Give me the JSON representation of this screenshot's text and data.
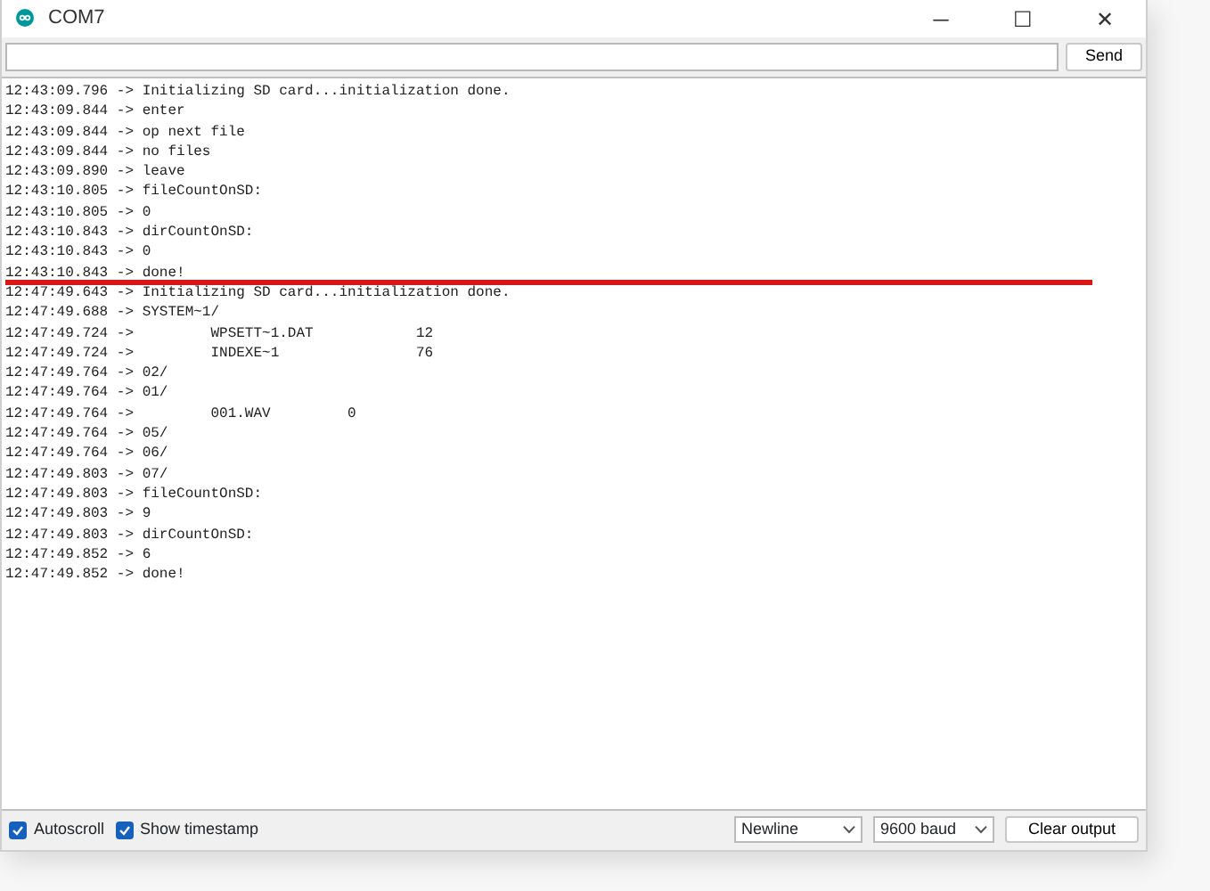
{
  "window": {
    "title": "COM7",
    "controls": [
      "─",
      "☐",
      "✕"
    ]
  },
  "input": {
    "button": "Send"
  },
  "output": {
    "lines": [
      {
        "text": "12:43:09.796 -> Initializing SD card...initialization done.",
        "marked": false
      },
      {
        "text": "12:43:09.844 -> enter",
        "marked": false
      },
      {
        "text": "12:43:09.844 -> op next file",
        "marked": false
      },
      {
        "text": "12:43:09.844 -> no files",
        "marked": false
      },
      {
        "text": "12:43:09.890 -> leave",
        "marked": false
      },
      {
        "text": "12:43:10.805 -> fileCountOnSD:",
        "marked": false
      },
      {
        "text": "12:43:10.805 -> 0",
        "marked": false
      },
      {
        "text": "12:43:10.843 -> dirCountOnSD:",
        "marked": false
      },
      {
        "text": "12:43:10.843 -> 0",
        "marked": false
      },
      {
        "text": "12:43:10.843 -> done!",
        "marked": true
      },
      {
        "text": "12:47:49.643 -> Initializing SD card...initialization done.",
        "marked": false
      },
      {
        "text": "12:47:49.688 -> SYSTEM~1/",
        "marked": false
      },
      {
        "text": "12:47:49.724 ->         WPSETT~1.DAT            12",
        "marked": false
      },
      {
        "text": "12:47:49.724 ->         INDEXE~1                76",
        "marked": false
      },
      {
        "text": "12:47:49.764 -> 02/",
        "marked": false
      },
      {
        "text": "12:47:49.764 -> 01/",
        "marked": false
      },
      {
        "text": "12:47:49.764 ->         001.WAV         0",
        "marked": false
      },
      {
        "text": "12:47:49.764 -> 05/",
        "marked": false
      },
      {
        "text": "12:47:49.764 -> 06/",
        "marked": false
      },
      {
        "text": "12:47:49.803 -> 07/",
        "marked": false
      },
      {
        "text": "12:47:49.803 -> fileCountOnSD:",
        "marked": false
      },
      {
        "text": "12:47:49.803 -> 9",
        "marked": false
      },
      {
        "text": "12:47:49.803 -> dirCountOnSD:",
        "marked": false
      },
      {
        "text": "12:47:49.852 -> 6",
        "marked": false
      },
      {
        "text": "12:47:49.852 -> done!",
        "marked": false
      }
    ]
  },
  "footer": {
    "checkboxes": [
      {
        "label": "Autoscroll",
        "checked": true
      },
      {
        "label": "Show timestamp",
        "checked": true
      }
    ],
    "line_ending": "Newline",
    "baud": "9600 baud",
    "clear_button": "Clear output"
  }
}
